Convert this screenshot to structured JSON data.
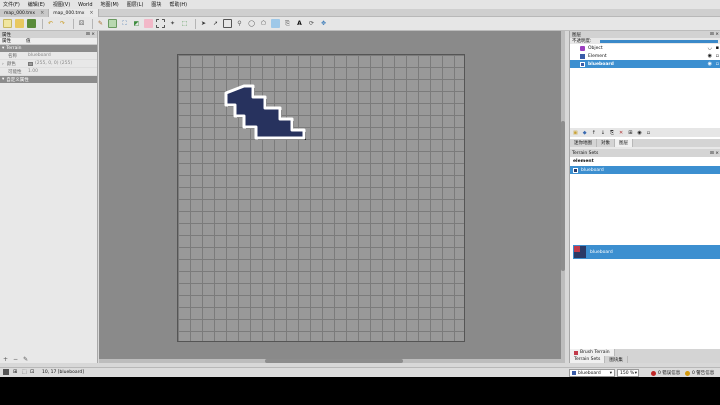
{
  "menubar": [
    "文件(F)",
    "编辑(E)",
    "视图(V)",
    "World",
    "地图(M)",
    "图层(L)",
    "图块",
    "帮助(H)"
  ],
  "tabs": [
    {
      "label": "map_000.tmx",
      "active": false
    },
    {
      "label": "map_000.tmx",
      "active": true
    }
  ],
  "properties_panel": {
    "title": "属性",
    "col_name": "属性",
    "col_value": "值",
    "section_terrain": "Terrain",
    "rows": [
      {
        "key": "名称",
        "value": "blueboard"
      },
      {
        "key": "颜色",
        "value": "(255, 0, 0) (255)"
      },
      {
        "key": "可能性",
        "value": "1.00"
      }
    ],
    "section_custom": "自定义属性"
  },
  "layers_panel": {
    "title": "图层",
    "opacity_label": "不透明度:",
    "layers": [
      {
        "name": "Object",
        "selected": false,
        "icon_color": "#9b3fbf"
      },
      {
        "name": "Element",
        "selected": false,
        "icon_color": "#3a5ca8"
      },
      {
        "name": "blueboard",
        "selected": true,
        "icon_color": "#3a5ca8"
      }
    ]
  },
  "right_tabs": [
    "迷你地图",
    "对象",
    "图层"
  ],
  "terrain_sets": {
    "title": "Terrain Sets",
    "tileset_name": "element",
    "terrains": [
      "blueboard"
    ],
    "selected_terrain": "blueboard"
  },
  "bottom_tabs_1": [
    "Brush Terrain"
  ],
  "bottom_tabs_2": [
    "Terrain Sets",
    "图块集"
  ],
  "status": {
    "coords": "10, 17 [blueboard]",
    "layer_select": "blueboard",
    "zoom": "150 %",
    "errors": "0 错误信息",
    "warnings": "0 警告信息"
  },
  "colors": {
    "tile_fill": "#27325e",
    "tile_outline": "#ffffff",
    "selection": "#3c8fd0"
  }
}
